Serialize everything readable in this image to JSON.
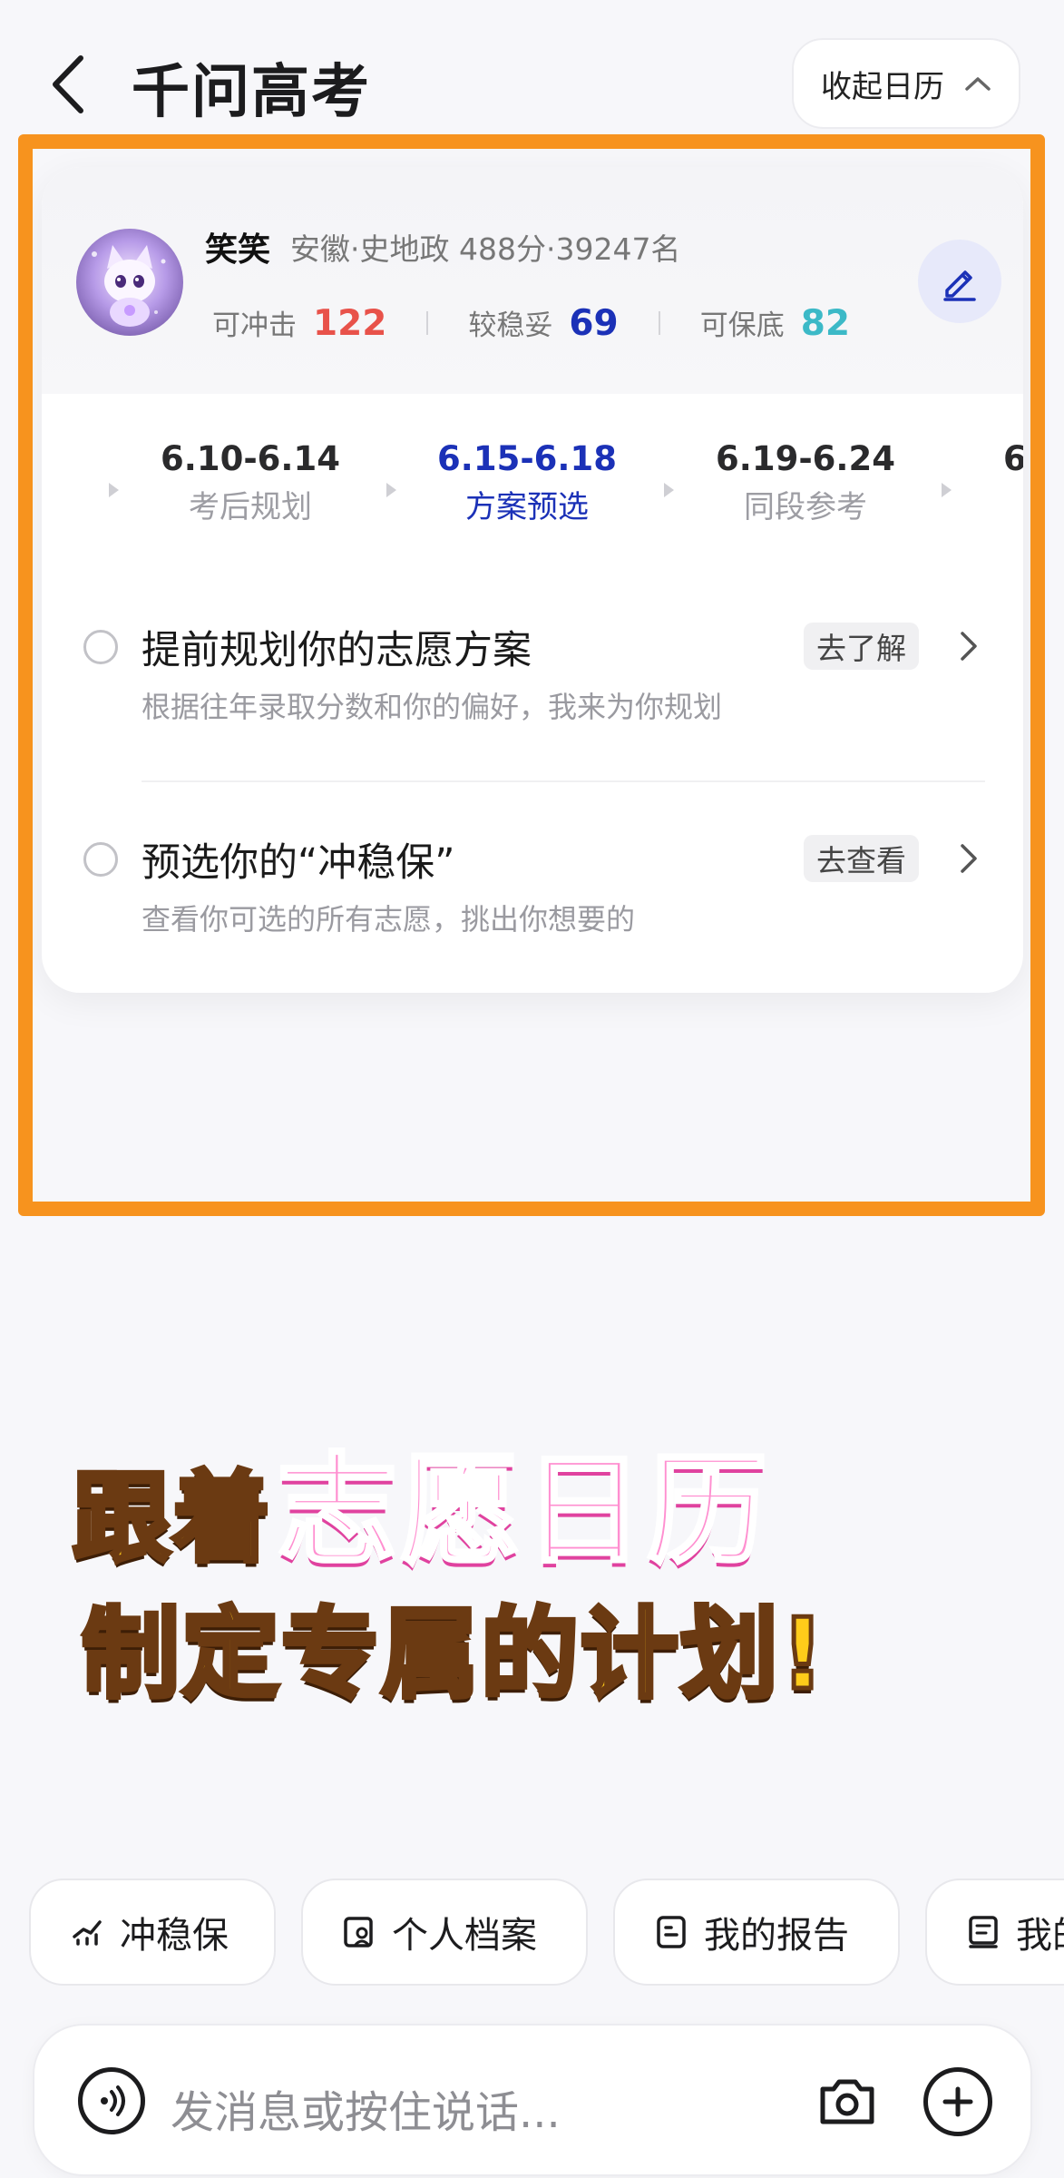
{
  "header": {
    "title": "千问高考",
    "collapse_label": "收起日历"
  },
  "profile": {
    "name": "笑笑",
    "info": "安徽·史地政 488分·39247名",
    "stats": [
      {
        "label": "可冲击",
        "value": "122",
        "color": "#e8524a"
      },
      {
        "label": "较稳妥",
        "value": "69",
        "color": "#1b31b7"
      },
      {
        "label": "可保底",
        "value": "82",
        "color": "#3cb9c7"
      }
    ]
  },
  "timeline": {
    "steps": [
      {
        "date": "6.10-6.14",
        "label": "考后规划",
        "active": false
      },
      {
        "date": "6.15-6.18",
        "label": "方案预选",
        "active": true
      },
      {
        "date": "6.19-6.24",
        "label": "同段参考",
        "active": false
      },
      {
        "date": "6",
        "label": "",
        "active": false
      }
    ]
  },
  "tasks": [
    {
      "title": "提前规划你的志愿方案",
      "desc": "根据往年录取分数和你的偏好，我来为你规划",
      "action": "去了解"
    },
    {
      "title": "预选你的“冲稳保”",
      "desc": "查看你可选的所有志愿，挑出你想要的",
      "action": "去查看"
    }
  ],
  "promo": {
    "line1_a": "跟着",
    "line1_b": "志愿日历",
    "line2": "制定专属的计划!"
  },
  "chips": [
    {
      "label": "冲稳保",
      "icon": "chart-icon"
    },
    {
      "label": "个人档案",
      "icon": "profile-card-icon"
    },
    {
      "label": "我的报告",
      "icon": "report-icon"
    },
    {
      "label": "我的",
      "icon": "document-icon"
    }
  ],
  "input": {
    "placeholder": "发消息或按住说话..."
  },
  "colors": {
    "accent": "#1b31b7",
    "frame": "#f7931e",
    "promo_yellow": "#ffcc1a",
    "promo_pink": "#ff8fd0"
  }
}
